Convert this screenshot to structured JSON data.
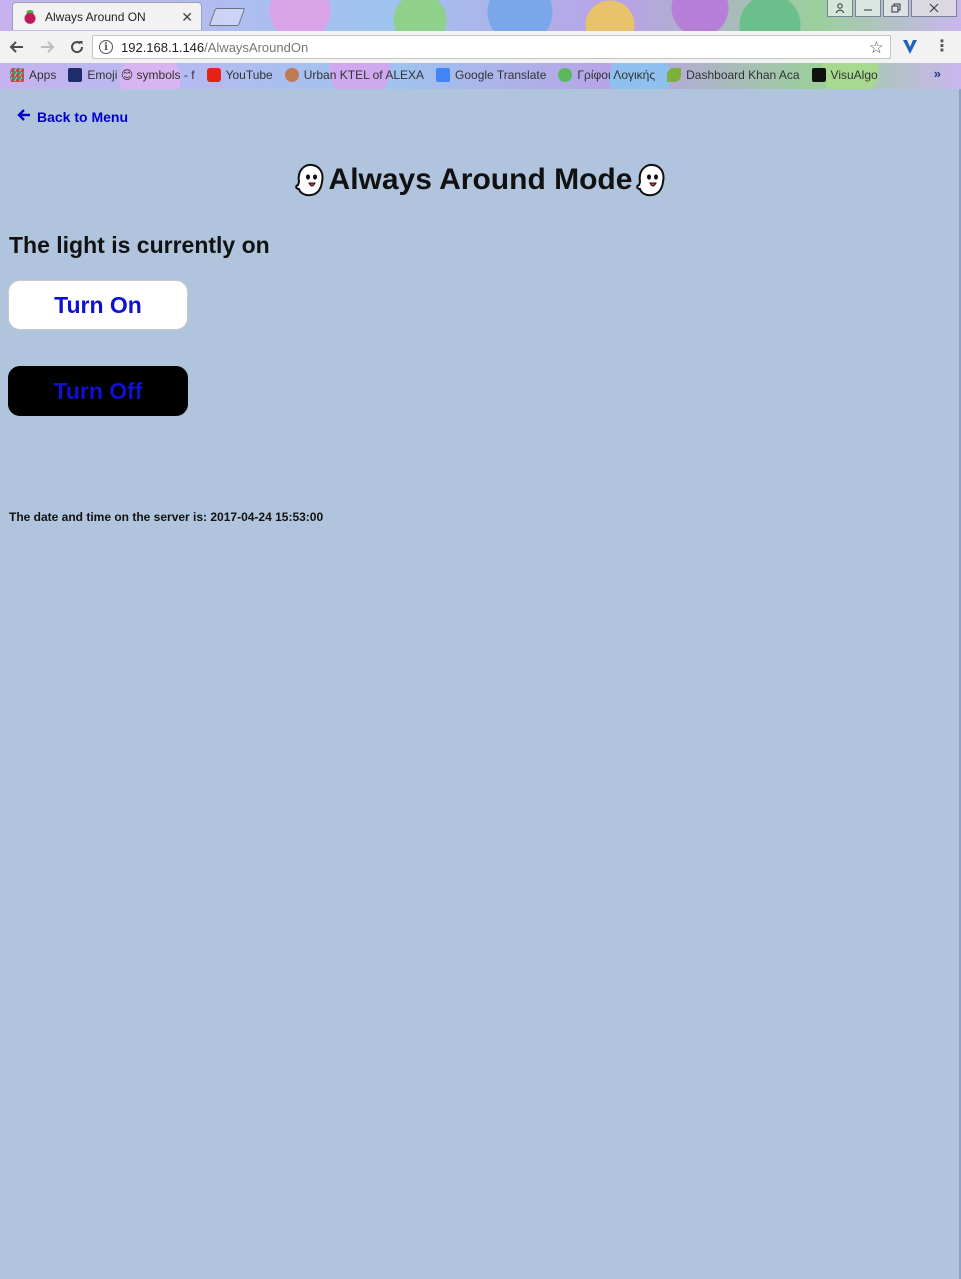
{
  "browser": {
    "tab_title": "Always Around ON",
    "tab_close": "✕",
    "address": {
      "host": "192.168.1.146",
      "path": "/AlwaysAroundOn"
    },
    "bookmarks": [
      {
        "label": "Apps",
        "icon": "apps-grid-icon"
      },
      {
        "label": "Emoji 😊 symbols - f",
        "icon": "heart-bookmark-icon"
      },
      {
        "label": "YouTube",
        "icon": "youtube-icon"
      },
      {
        "label": "Urban KTEL of ALEXA",
        "icon": "bus-icon"
      },
      {
        "label": "Google Translate",
        "icon": "translate-icon"
      },
      {
        "label": "Γρίφοι Λογικής",
        "icon": "puzzle-icon"
      },
      {
        "label": "Dashboard Khan Aca",
        "icon": "leaf-icon"
      },
      {
        "label": "VisuAlgo",
        "icon": "visualgo-icon"
      }
    ],
    "bookmarks_overflow": "»"
  },
  "page": {
    "background": "#b0c4de",
    "back_link": "Back to Menu",
    "back_arrow": "🡐",
    "title": "Always Around Mode",
    "title_emoji": "ghost-icon",
    "status": "The light is currently on",
    "turn_on_label": "Turn On",
    "turn_off_label": "Turn Off",
    "button_text_color": "#1010d0",
    "datetime": "The date and time on the server is: 2017-04-24 15:53:00"
  }
}
